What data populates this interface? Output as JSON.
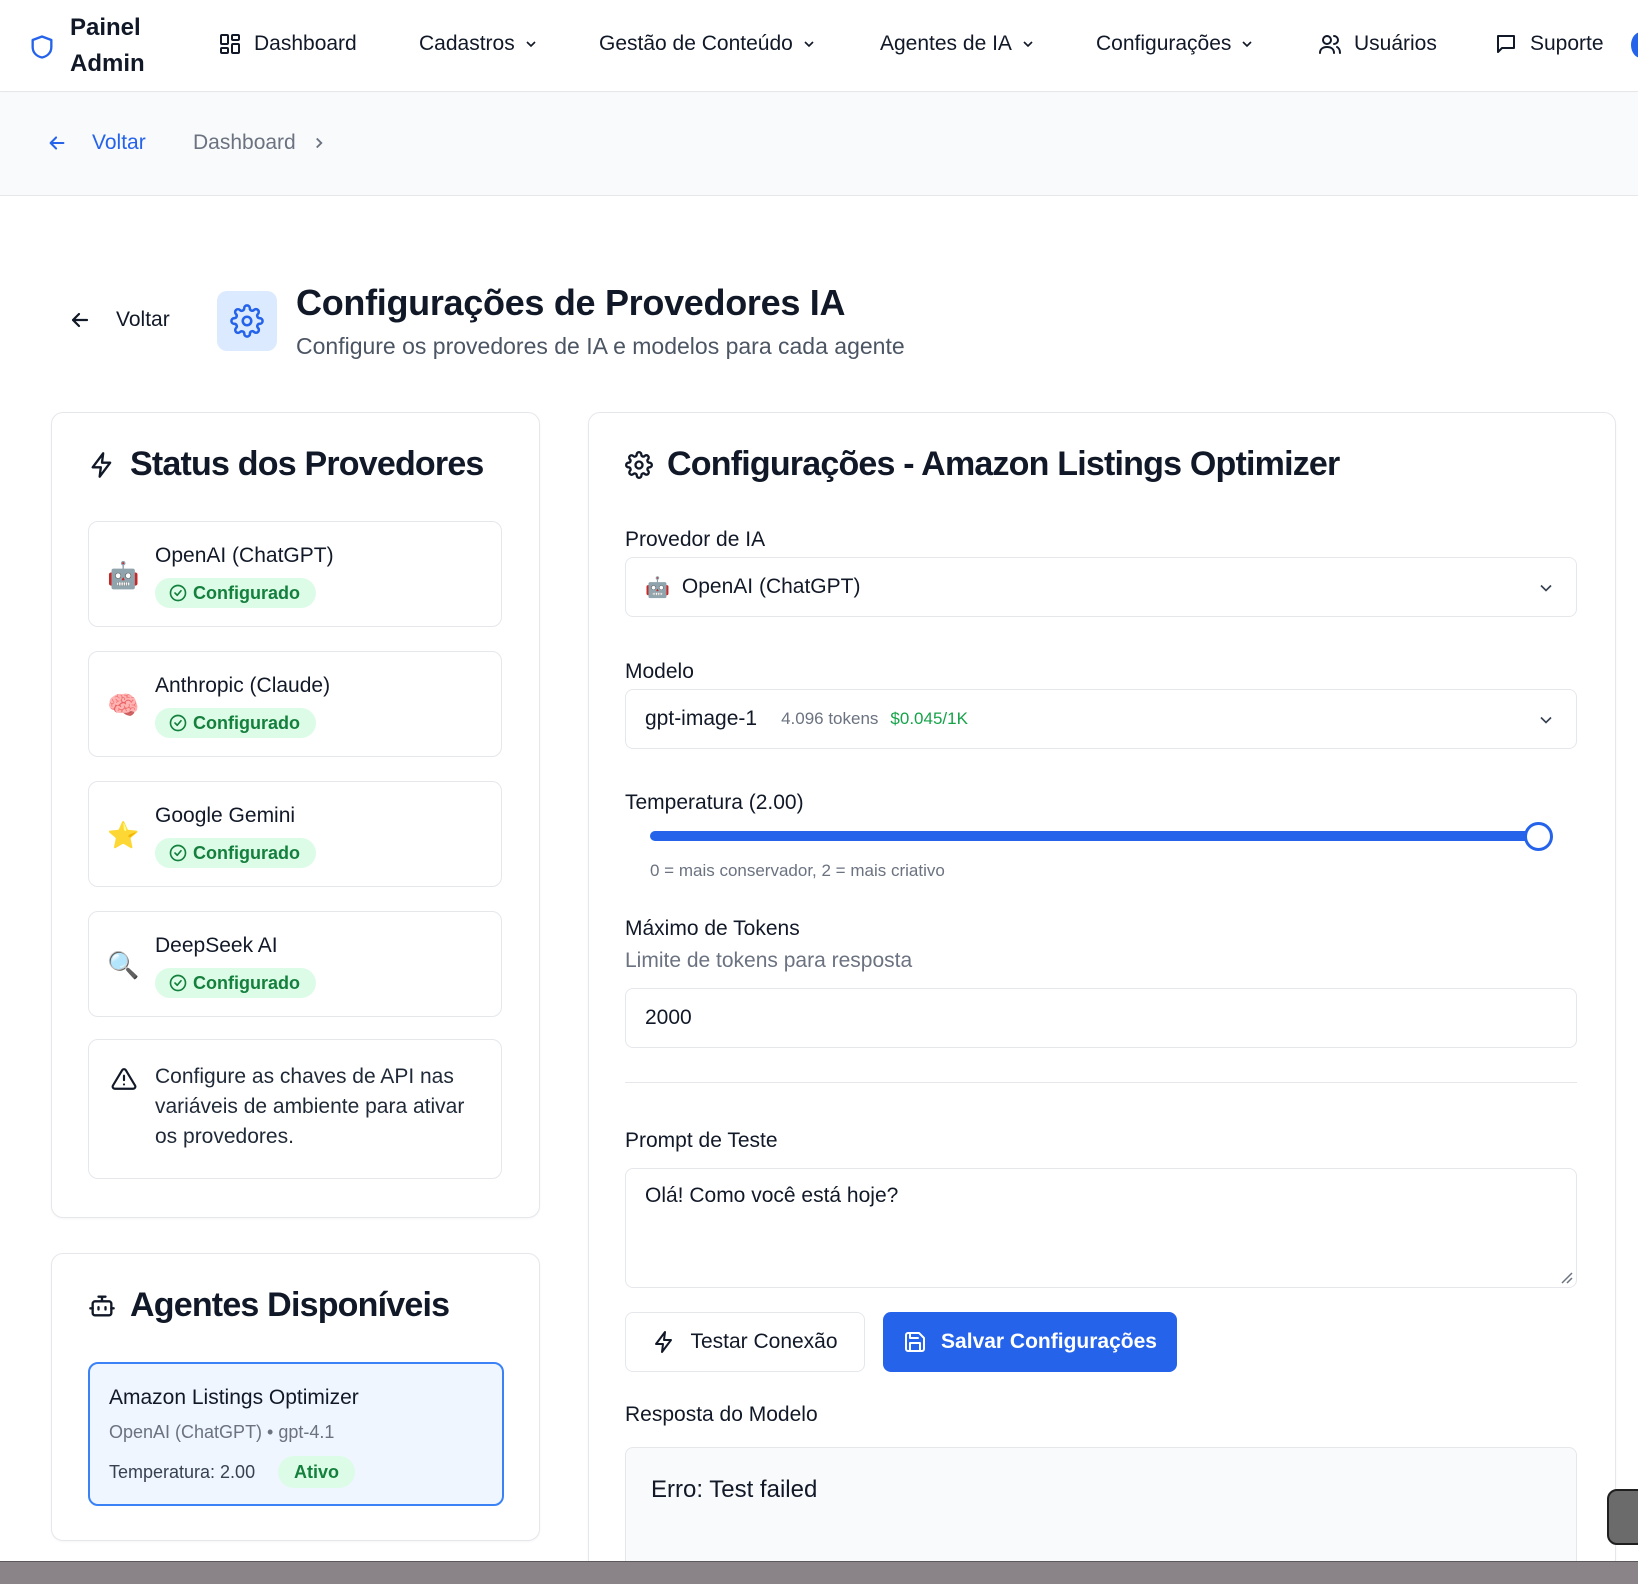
{
  "nav": {
    "brand_line1": "Painel",
    "brand_line2": "Admin",
    "items": [
      {
        "label": "Dashboard",
        "icon": "grid-icon"
      },
      {
        "label": "Cadastros",
        "dropdown": true
      },
      {
        "label": "Gestão de Conteúdo",
        "dropdown": true
      },
      {
        "label": "Agentes de IA",
        "dropdown": true
      },
      {
        "label": "Configurações",
        "dropdown": true
      },
      {
        "label": "Usuários",
        "icon": "users-icon"
      },
      {
        "label": "Suporte",
        "icon": "message-square-icon"
      }
    ]
  },
  "breadcrumb": {
    "back_label": "Voltar",
    "current": "Dashboard"
  },
  "header": {
    "back_label": "Voltar",
    "title": "Configurações de Provedores IA",
    "subtitle": "Configure os provedores de IA e modelos para cada agente"
  },
  "status_panel": {
    "title": "Status dos Provedores",
    "providers": [
      {
        "name": "OpenAI (ChatGPT)",
        "emoji": "🤖",
        "status": "Configurado"
      },
      {
        "name": "Anthropic (Claude)",
        "emoji": "🧠",
        "status": "Configurado"
      },
      {
        "name": "Google Gemini",
        "emoji": "⭐",
        "status": "Configurado"
      },
      {
        "name": "DeepSeek AI",
        "emoji": "🔍",
        "status": "Configurado"
      }
    ],
    "warning": "Configure as chaves de API nas variáveis de ambiente para ativar os provedores."
  },
  "agents_panel": {
    "title": "Agentes Disponíveis",
    "agents": [
      {
        "name": "Amazon Listings Optimizer",
        "meta": "OpenAI (ChatGPT) • gpt-4.1",
        "temperature": "Temperatura: 2.00",
        "status": "Ativo"
      }
    ]
  },
  "config": {
    "title": "Configurações - Amazon Listings Optimizer",
    "provider_label": "Provedor de IA",
    "provider_emoji": "🤖",
    "provider_value": "OpenAI (ChatGPT)",
    "model_label": "Modelo",
    "model_value": "gpt-image-1",
    "model_tokens": "4.096 tokens",
    "model_price": "$0.045/1K",
    "temperature_label": "Temperatura (2.00)",
    "temperature_value": 2.0,
    "temperature_max": 2.0,
    "temperature_hint": "0 = mais conservador, 2 = mais criativo",
    "max_tokens_label": "Máximo de Tokens",
    "max_tokens_hint": "Limite de tokens para resposta",
    "max_tokens_value": "2000",
    "prompt_label": "Prompt de Teste",
    "prompt_value": "Olá! Como você está hoje?",
    "test_button": "Testar Conexão",
    "save_button": "Salvar Configurações",
    "response_label": "Resposta do Modelo",
    "response_value": "Erro: Test failed"
  },
  "colors": {
    "accent": "#2563eb",
    "success_bg": "#dcfce7",
    "success_text": "#15803d"
  }
}
